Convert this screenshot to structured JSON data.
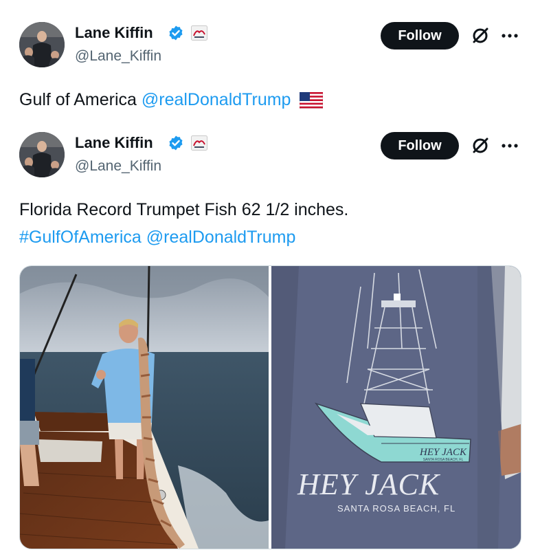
{
  "first_tweet": {
    "author": {
      "name": "Lane Kiffin",
      "handle": "@Lane_Kiffin",
      "verified": true,
      "team_icon": "ole-miss-logo-icon"
    },
    "follow_label": "Follow",
    "text_plain": "Gulf of America ",
    "mention": "@realDonaldTrump",
    "emoji": "us-flag-icon"
  },
  "second_tweet": {
    "author": {
      "name": "Lane Kiffin",
      "handle": "@Lane_Kiffin",
      "verified": true,
      "team_icon": "ole-miss-logo-icon"
    },
    "follow_label": "Follow",
    "line1": "Florida Record Trumpet Fish 62 1/2 inches.",
    "hashtag": "#GulfOfAmerica",
    "mention": "@realDonaldTrump"
  },
  "media": {
    "shirt": {
      "brand": "HEY JACK",
      "boat_name": "HEY JACK",
      "boat_subtext": "SANTA ROSA BEACH, FL",
      "location": "SANTA ROSA BEACH, FL"
    }
  },
  "colors": {
    "link": "#1d9bf0",
    "text": "#0f1419",
    "secondary": "#536471",
    "verified": "#1d9bf0"
  }
}
